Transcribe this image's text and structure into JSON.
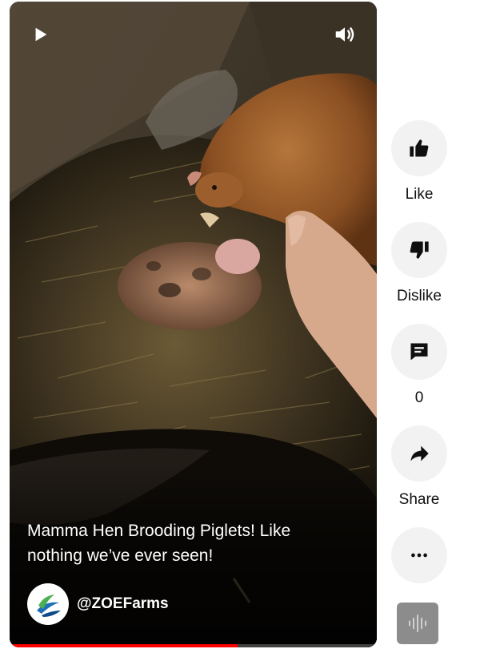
{
  "video": {
    "title": "Mamma Hen Brooding Piglets! Like nothing we’ve ever seen!",
    "channel": "@ZOEFarms",
    "progress_fraction": 0.62,
    "progress_color": "#ff0000"
  },
  "controls": {
    "play_icon": "play-icon",
    "volume_icon": "volume-icon"
  },
  "actions": {
    "like": {
      "label": "Like",
      "icon": "thumbs-up-icon"
    },
    "dislike": {
      "label": "Dislike",
      "icon": "thumbs-down-icon"
    },
    "comments": {
      "count": "0",
      "icon": "comment-icon"
    },
    "share": {
      "label": "Share",
      "icon": "share-arrow-icon"
    },
    "more": {
      "icon": "more-horizontal-icon"
    },
    "sound": {
      "icon": "sound-waveform-icon"
    }
  }
}
